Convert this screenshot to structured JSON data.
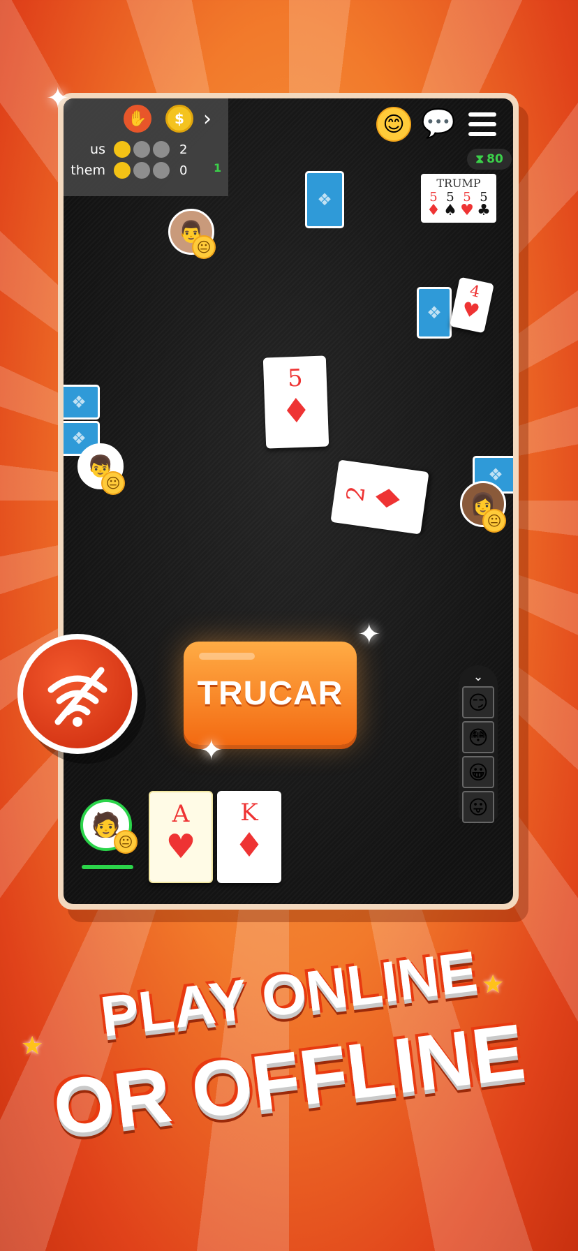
{
  "score": {
    "rows": [
      {
        "label": "us",
        "dots": [
          true,
          false,
          false
        ],
        "points": "2"
      },
      {
        "label": "them",
        "dots": [
          true,
          false,
          false
        ],
        "points": "0"
      }
    ],
    "side_count": "1"
  },
  "timer": {
    "icon": "hourglass-icon",
    "value": "80"
  },
  "trump": {
    "title": "TRUMP",
    "cards": [
      {
        "rank": "5",
        "suit": "♦",
        "color": "red"
      },
      {
        "rank": "5",
        "suit": "♠",
        "color": "black"
      },
      {
        "rank": "5",
        "suit": "♥",
        "color": "red"
      },
      {
        "rank": "5",
        "suit": "♣",
        "color": "black"
      }
    ]
  },
  "table_cards": [
    {
      "rank": "5",
      "suit": "♦"
    },
    {
      "rank": "2",
      "suit": "♦"
    },
    {
      "rank": "4",
      "suit": "♥"
    }
  ],
  "hand": [
    {
      "rank": "A",
      "suit": "♥"
    },
    {
      "rank": "K",
      "suit": "♦"
    }
  ],
  "trucar_label": "TRUCAR",
  "headline": {
    "line1": "PLAY ONLINE",
    "line2": "OR OFFLINE"
  },
  "emoji_tray": [
    "😏",
    "😳",
    "😀",
    "😛"
  ],
  "colors": {
    "accent": "#f36a12",
    "card_back": "#2f9ad8",
    "active": "#2bd44a"
  }
}
